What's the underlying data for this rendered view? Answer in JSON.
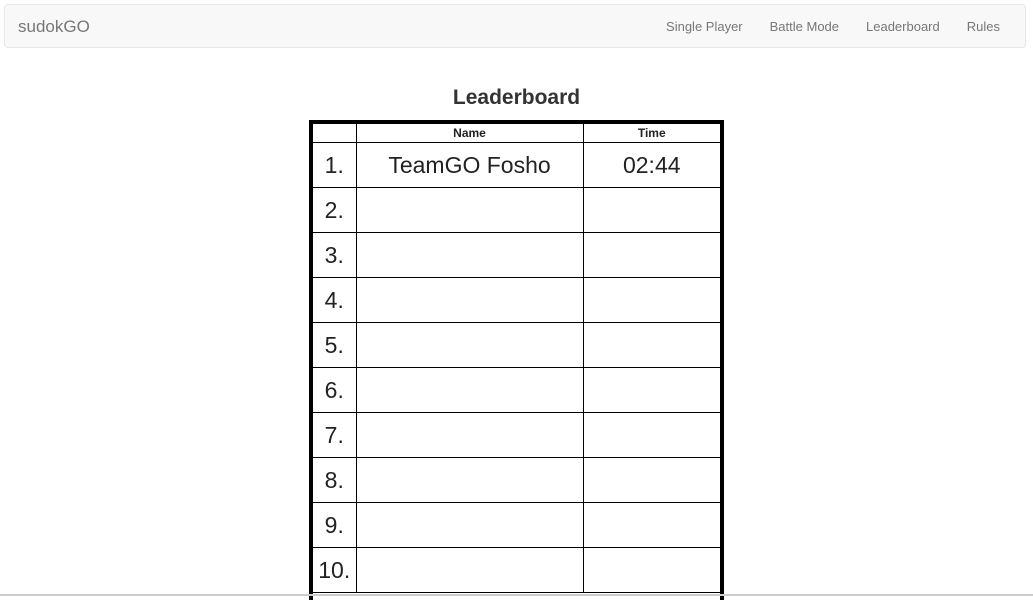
{
  "navbar": {
    "brand": "sudokGO",
    "links": [
      "Single Player",
      "Battle Mode",
      "Leaderboard",
      "Rules"
    ]
  },
  "page": {
    "title": "Leaderboard"
  },
  "leaderboard": {
    "headers": [
      "",
      "Name",
      "Time"
    ],
    "rows": [
      {
        "rank": "1.",
        "name": "TeamGO Fosho",
        "time": "02:44"
      },
      {
        "rank": "2.",
        "name": "",
        "time": ""
      },
      {
        "rank": "3.",
        "name": "",
        "time": ""
      },
      {
        "rank": "4.",
        "name": "",
        "time": ""
      },
      {
        "rank": "5.",
        "name": "",
        "time": ""
      },
      {
        "rank": "6.",
        "name": "",
        "time": ""
      },
      {
        "rank": "7.",
        "name": "",
        "time": ""
      },
      {
        "rank": "8.",
        "name": "",
        "time": ""
      },
      {
        "rank": "9.",
        "name": "",
        "time": ""
      },
      {
        "rank": "10.",
        "name": "",
        "time": ""
      }
    ]
  }
}
